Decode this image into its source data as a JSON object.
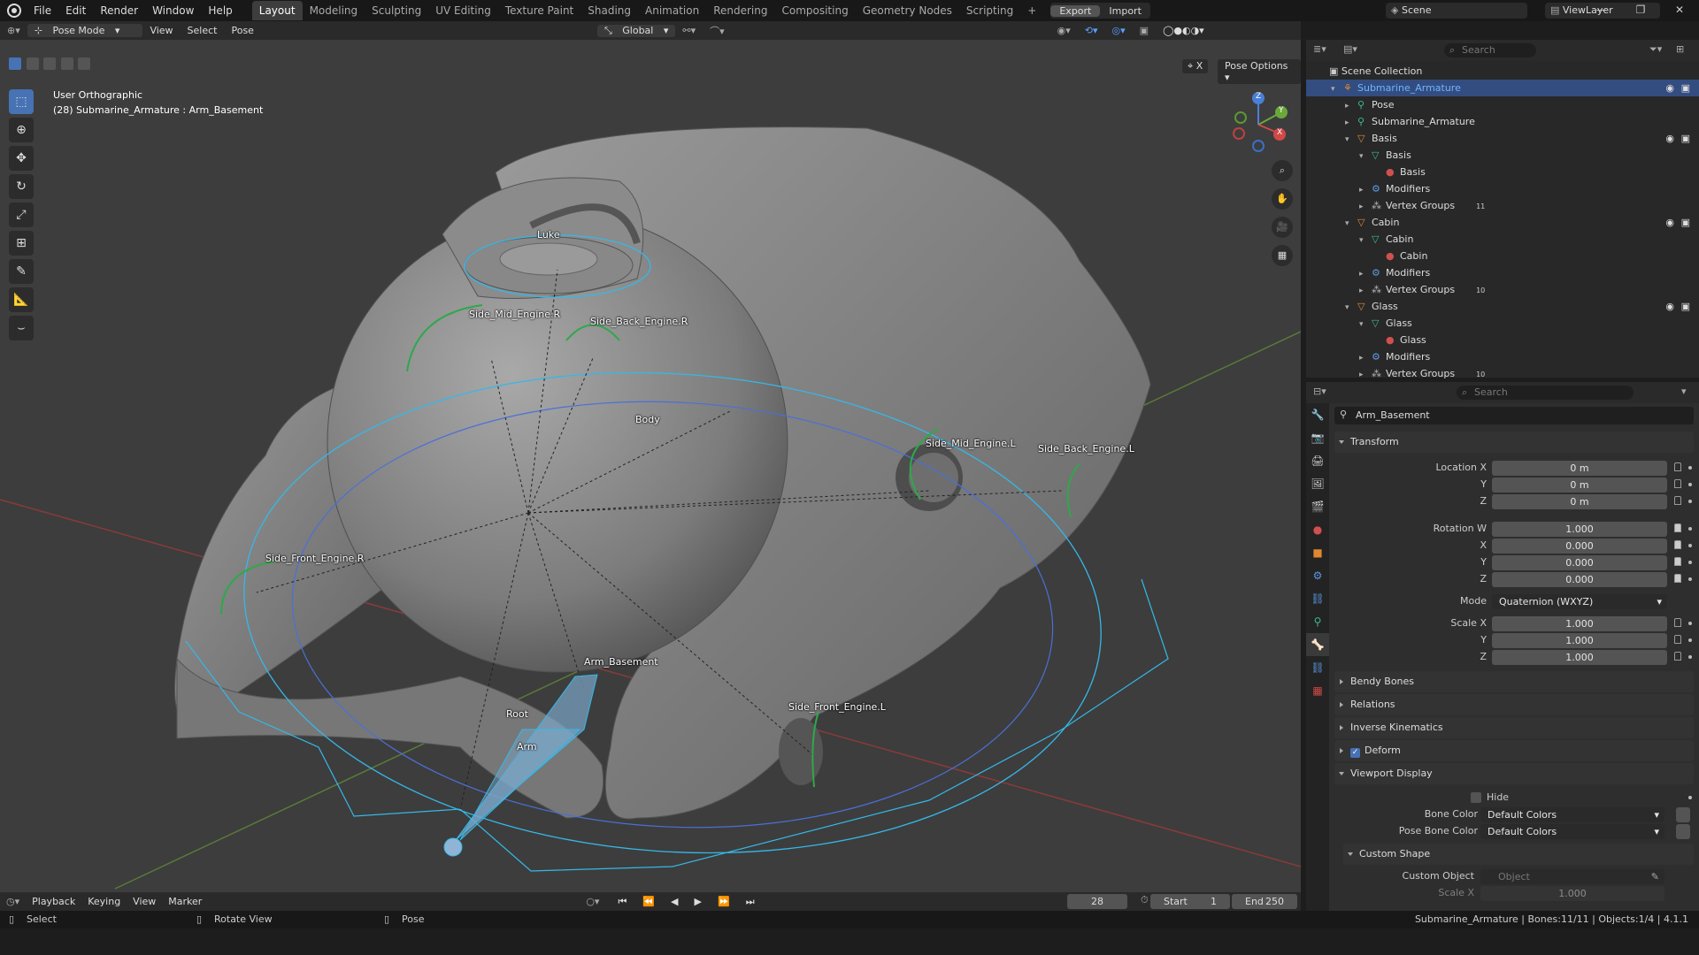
{
  "app": {
    "menus": [
      "File",
      "Edit",
      "Render",
      "Window",
      "Help"
    ],
    "workspaces": [
      "Layout",
      "Modeling",
      "Sculpting",
      "UV Editing",
      "Texture Paint",
      "Shading",
      "Animation",
      "Rendering",
      "Compositing",
      "Geometry Nodes",
      "Scripting"
    ],
    "active_workspace": "Layout",
    "export_label": "Export",
    "import_label": "Import",
    "scene": "Scene",
    "view_layer": "ViewLayer"
  },
  "viewport": {
    "mode": "Pose Mode",
    "menus": [
      "View",
      "Select",
      "Pose"
    ],
    "transform_orientation": "Global",
    "pose_options": "Pose Options",
    "x_label": "X",
    "view_name": "User Orthographic",
    "active_info": "(28) Submarine_Armature : Arm_Basement",
    "bones": [
      "Luke",
      "Side_Mid_Engine.R",
      "Side_Back_Engine.R",
      "Body",
      "Side_Mid_Engine.L",
      "Side_Back_Engine.L",
      "Side_Front_Engine.R",
      "Arm_Basement",
      "Root",
      "Arm",
      "Side_Front_Engine.L"
    ],
    "gizmo_axes": [
      "Z",
      "Y",
      "X"
    ]
  },
  "outliner": {
    "search_placeholder": "Search",
    "root": "Scene Collection",
    "items": [
      {
        "label": "Submarine_Armature",
        "indent": 0,
        "selected": true
      },
      {
        "label": "Pose",
        "indent": 1
      },
      {
        "label": "Submarine_Armature",
        "indent": 1
      },
      {
        "label": "Basis",
        "indent": 1
      },
      {
        "label": "Basis",
        "indent": 2
      },
      {
        "label": "Basis",
        "indent": 3
      },
      {
        "label": "Modifiers",
        "indent": 2
      },
      {
        "label": "Vertex Groups",
        "indent": 2,
        "badge": "11"
      },
      {
        "label": "Cabin",
        "indent": 1
      },
      {
        "label": "Cabin",
        "indent": 2
      },
      {
        "label": "Cabin",
        "indent": 3
      },
      {
        "label": "Modifiers",
        "indent": 2
      },
      {
        "label": "Vertex Groups",
        "indent": 2,
        "badge": "10"
      },
      {
        "label": "Glass",
        "indent": 1
      },
      {
        "label": "Glass",
        "indent": 2
      },
      {
        "label": "Glass",
        "indent": 3
      },
      {
        "label": "Modifiers",
        "indent": 2
      },
      {
        "label": "Vertex Groups",
        "indent": 2,
        "badge": "10"
      }
    ]
  },
  "properties": {
    "search_placeholder": "Search",
    "bone_name": "Arm_Basement",
    "transform": {
      "title": "Transform",
      "location_label": "Location X",
      "y_label": "Y",
      "z_label": "Z",
      "w_label": "Rotation W",
      "x_label": "X",
      "loc_x": "0 m",
      "loc_y": "0 m",
      "loc_z": "0 m",
      "rot_w": "1.000",
      "rot_x": "0.000",
      "rot_y": "0.000",
      "rot_z": "0.000",
      "mode_label": "Mode",
      "mode": "Quaternion (WXYZ)",
      "scale_label": "Scale X",
      "scale_x": "1.000",
      "scale_y": "1.000",
      "scale_z": "1.000"
    },
    "sections": [
      "Bendy Bones",
      "Relations",
      "Inverse Kinematics",
      "Deform"
    ],
    "viewport_display": {
      "title": "Viewport Display",
      "hide_label": "Hide",
      "bone_color_label": "Bone Color",
      "bone_color": "Default Colors",
      "pose_bone_color_label": "Pose Bone Color",
      "pose_bone_color": "Default Colors",
      "custom_shape_title": "Custom Shape",
      "custom_object_label": "Custom Object",
      "custom_object_placeholder": "Object",
      "scale_label": "Scale X",
      "scale_x": "1.000"
    }
  },
  "timeline": {
    "menus": [
      "Playback",
      "Keying",
      "View",
      "Marker"
    ],
    "current_frame": "28",
    "start_label": "Start",
    "start": "1",
    "end_label": "End",
    "end": "250"
  },
  "status": {
    "select": "Select",
    "rotate": "Rotate View",
    "pose": "Pose",
    "info": "Submarine_Armature | Bones:11/11 | Objects:1/4 | 4.1.1"
  }
}
